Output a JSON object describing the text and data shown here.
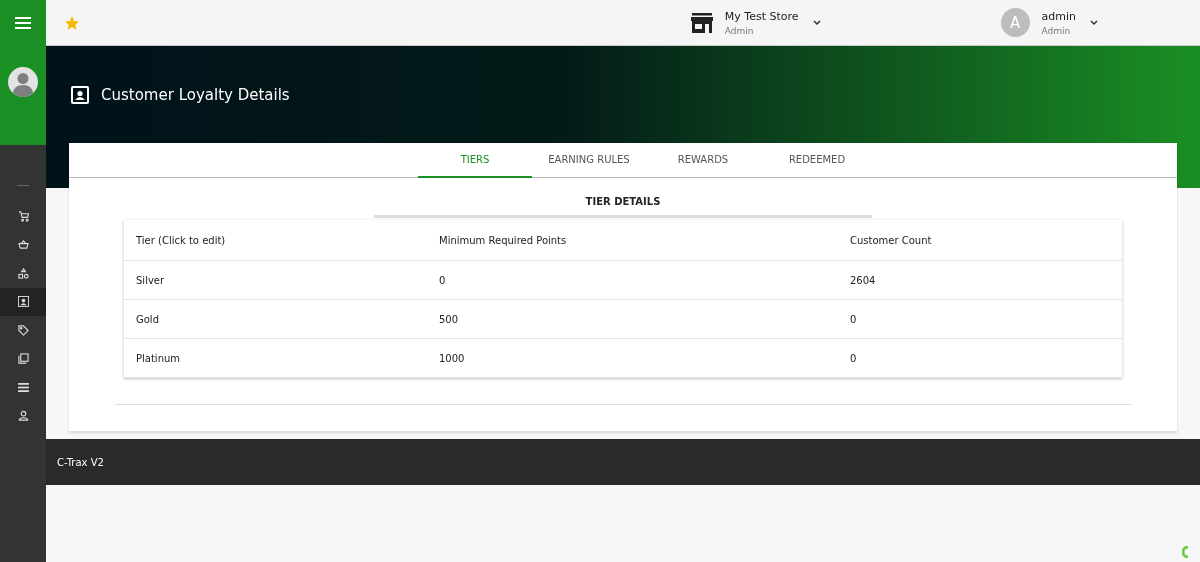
{
  "topbar": {
    "store": {
      "name": "My Test Store",
      "role": "Admin"
    },
    "user": {
      "initial": "A",
      "name": "admin",
      "role": "Admin"
    }
  },
  "sidebar": {
    "items": [
      {
        "selected": false
      },
      {
        "selected": false
      },
      {
        "selected": false
      },
      {
        "selected": true
      },
      {
        "selected": false
      },
      {
        "selected": false
      },
      {
        "selected": false
      },
      {
        "selected": false
      }
    ]
  },
  "page": {
    "title": "Customer Loyalty Details"
  },
  "tabs": [
    {
      "label": "TIERS",
      "selected": true
    },
    {
      "label": "EARNING RULES",
      "selected": false
    },
    {
      "label": "REWARDS",
      "selected": false
    },
    {
      "label": "REDEEMED",
      "selected": false
    }
  ],
  "section_title": "TIER DETAILS",
  "table": {
    "columns": [
      "Tier (Click to edit)",
      "Minimum Required Points",
      "Customer Count"
    ],
    "rows": [
      [
        "Silver",
        "0",
        "2604"
      ],
      [
        "Gold",
        "500",
        "0"
      ],
      [
        "Platinum",
        "1000",
        "0"
      ]
    ]
  },
  "footer": {
    "text": "C-Trax V2"
  }
}
